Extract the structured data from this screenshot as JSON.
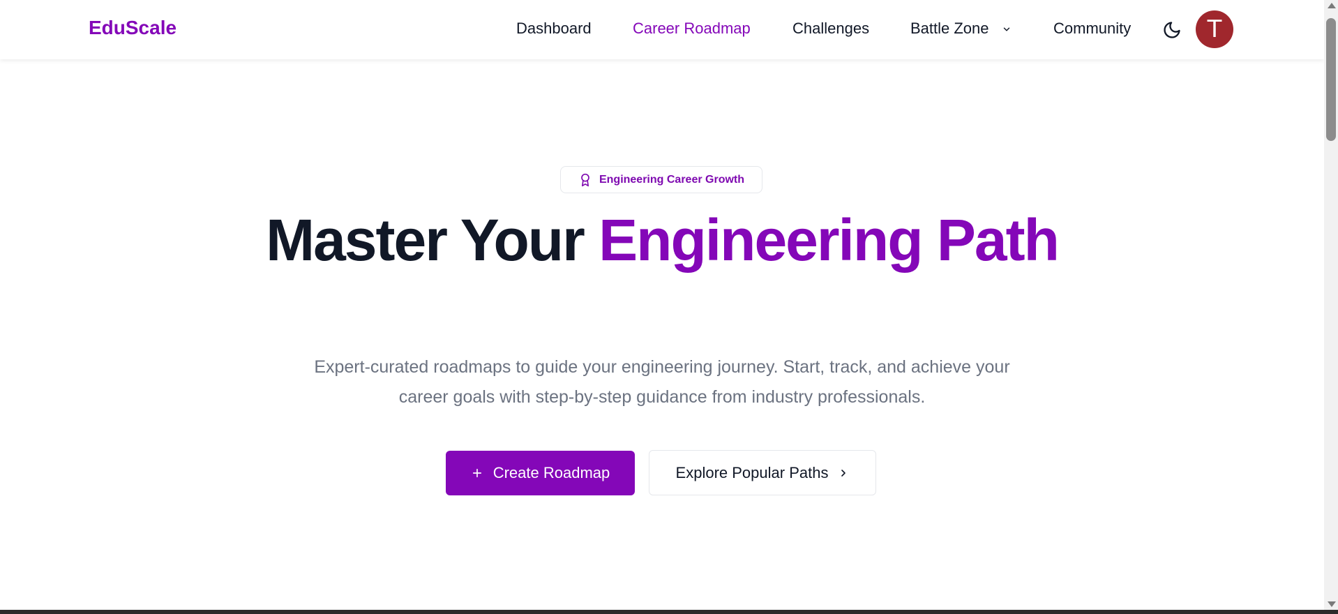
{
  "app": {
    "brand": "EduScale"
  },
  "nav": {
    "items": [
      {
        "label": "Dashboard"
      },
      {
        "label": "Career Roadmap",
        "active": true
      },
      {
        "label": "Challenges"
      },
      {
        "label": "Battle Zone",
        "has_dropdown": true
      },
      {
        "label": "Community"
      }
    ],
    "theme_toggle_icon": "moon-icon",
    "avatar_initial": "T"
  },
  "hero": {
    "badge": {
      "icon": "award-icon",
      "label": "Engineering Career Growth"
    },
    "headline_part1": "Master Your ",
    "headline_part2": "Engineering Path",
    "subtitle": "Expert-curated roadmaps to guide your engineering journey. Start, track, and achieve your career goals with step-by-step guidance from industry professionals.",
    "primary_button": {
      "icon": "plus-icon",
      "label": "Create Roadmap"
    },
    "secondary_button": {
      "label": "Explore Popular Paths",
      "icon": "chevron-right-icon"
    }
  },
  "colors": {
    "accent": "#8407b8",
    "avatar": "#a0272d",
    "text": "#111827",
    "muted": "#6b7280"
  }
}
